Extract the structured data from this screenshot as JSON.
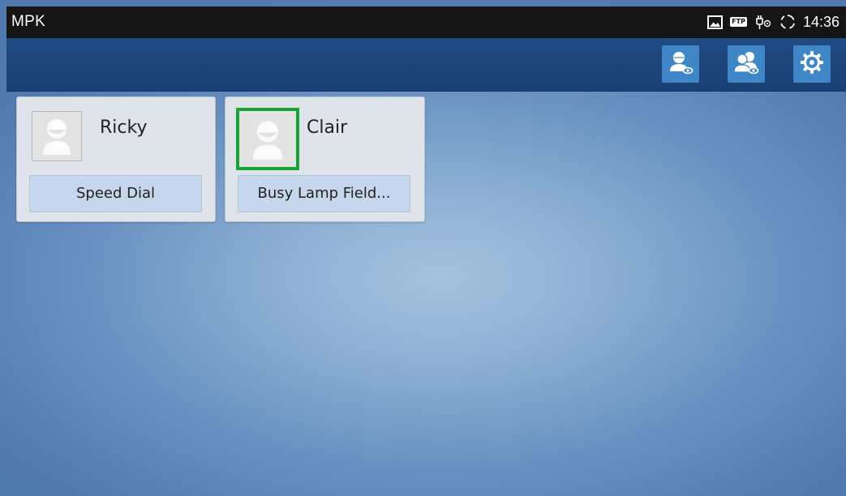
{
  "status_bar": {
    "app_title": "MPK",
    "icons": [
      "image-icon",
      "ftp-icon",
      "usb-icon",
      "sync-icon"
    ],
    "ftp_label": "FTP",
    "time": "14:36"
  },
  "action_bar": {
    "buttons": [
      "contact-view-icon",
      "group-view-icon",
      "settings-gear-icon"
    ],
    "color": "#3f86c7",
    "background": "#1c4479"
  },
  "cards": [
    {
      "name": "Ricky",
      "mode": "Speed Dial",
      "active": false
    },
    {
      "name": "Clair",
      "mode": "Busy Lamp Field...",
      "active": true
    }
  ],
  "colors": {
    "active_indicator": "#1aa335",
    "card_background": "#dfe3ea",
    "mode_button": "#c6d6ec"
  }
}
